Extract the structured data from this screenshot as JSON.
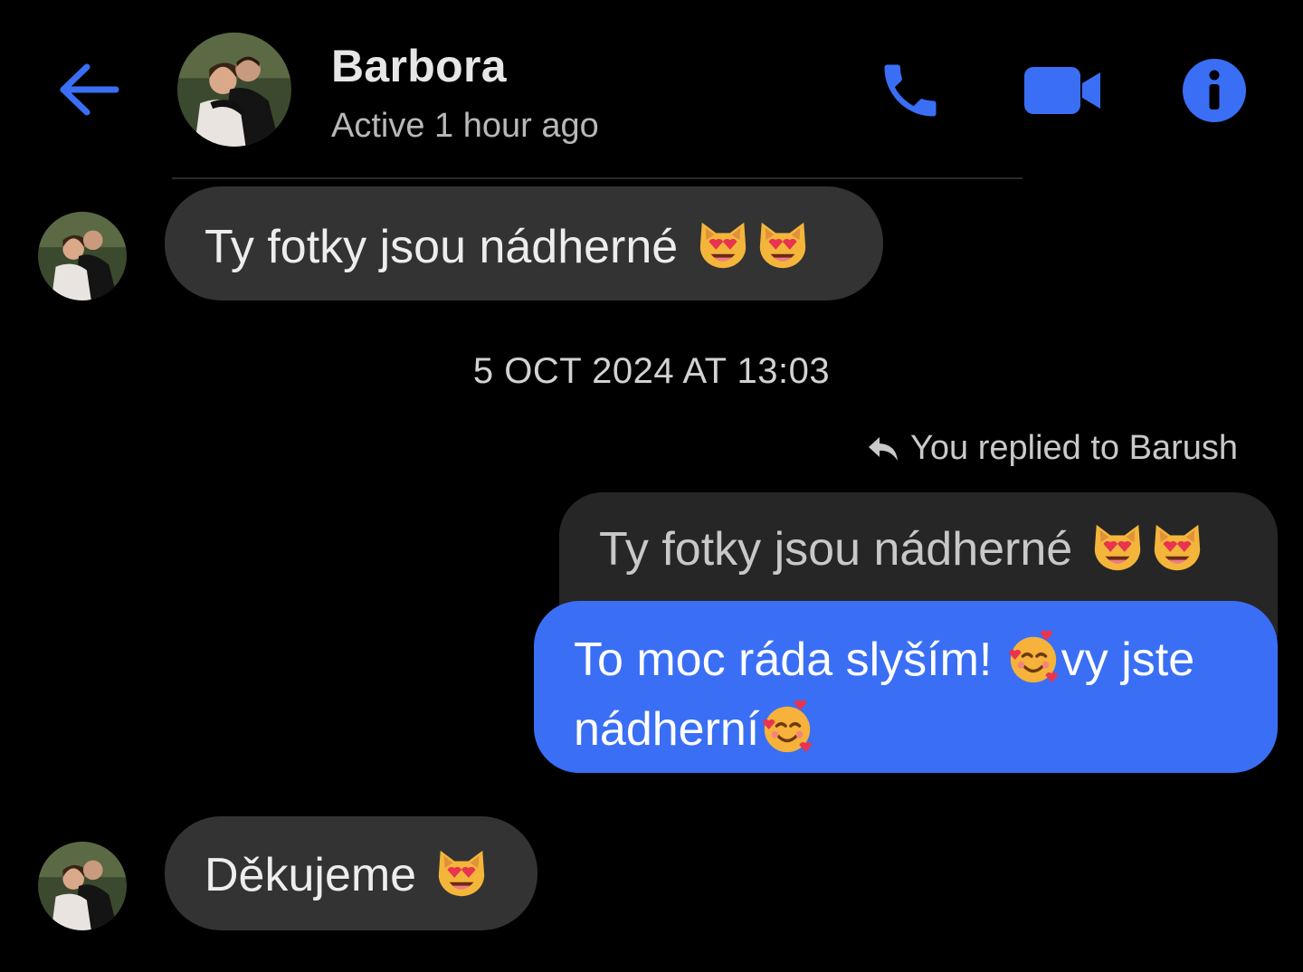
{
  "header": {
    "contact_name": "Barbora",
    "status": "Active 1 hour ago",
    "icons": [
      "back-arrow-icon",
      "phone-icon",
      "video-camera-icon",
      "info-icon"
    ],
    "accent_color": "#3a6ff5"
  },
  "messages": [
    {
      "direction": "incoming",
      "text": "Ty fotky jsou nádherné",
      "emoji": [
        "smiling-cat-heart-eyes",
        "smiling-cat-heart-eyes"
      ]
    },
    {
      "type": "timestamp",
      "text": "5 OCT 2024 AT 13:03"
    },
    {
      "type": "reply_note",
      "text": "You replied to Barush"
    },
    {
      "direction": "quoted",
      "text": "Ty fotky jsou nádherné",
      "emoji": [
        "smiling-cat-heart-eyes",
        "smiling-cat-heart-eyes"
      ]
    },
    {
      "direction": "outgoing",
      "line1": "To moc ráda slyším! ",
      "line1_after": "vy jste",
      "line2": "nádherní",
      "emoji": [
        "smiling-face-with-hearts",
        "smiling-face-with-hearts"
      ]
    },
    {
      "direction": "incoming",
      "text": "Děkujeme",
      "emoji": [
        "smiling-cat-heart-eyes"
      ]
    }
  ]
}
